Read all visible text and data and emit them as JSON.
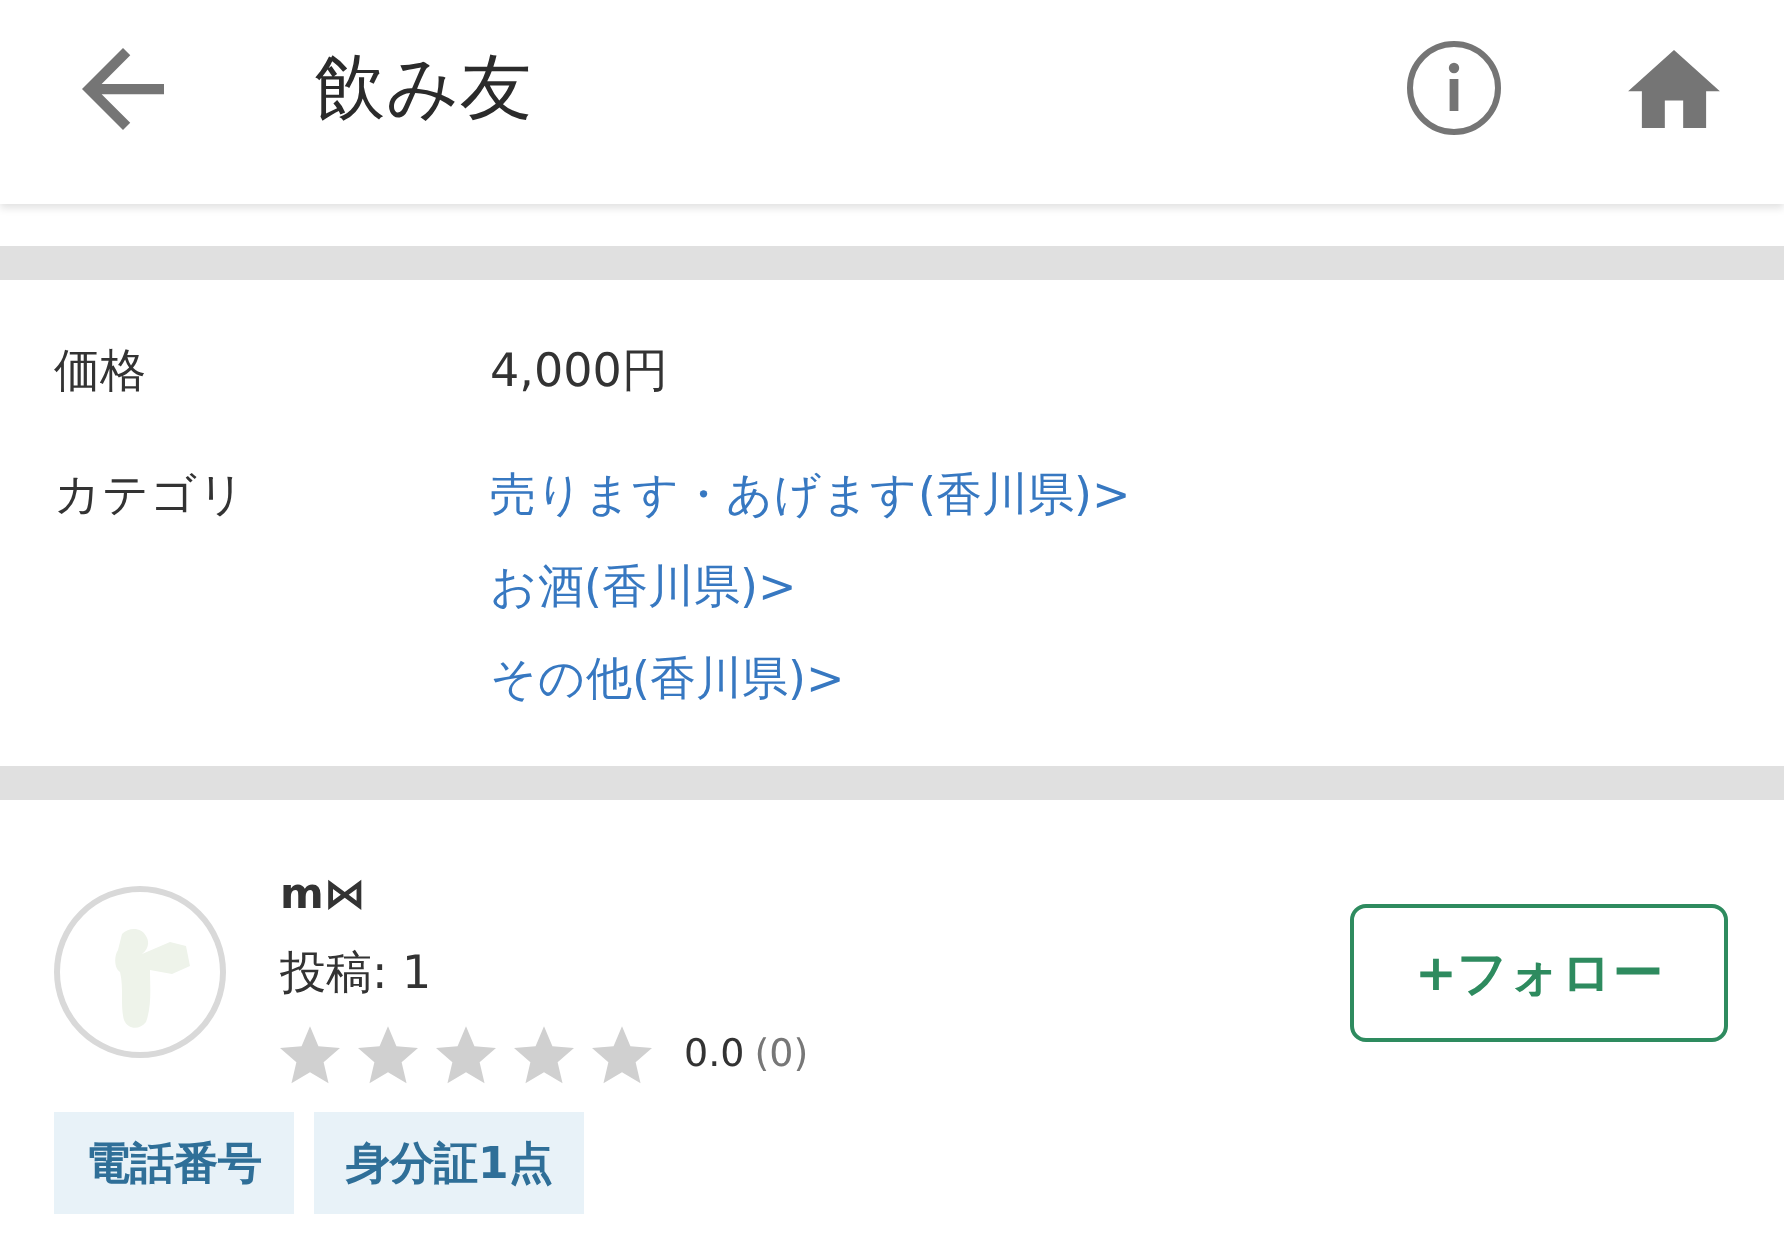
{
  "header": {
    "title": "飲み友"
  },
  "details": [
    {
      "label": "価格",
      "values": [
        {
          "text": "4,000円",
          "kind": "text"
        }
      ]
    },
    {
      "label": "カテゴリ",
      "values": [
        {
          "text": "売ります・あげます(香川県)>",
          "kind": "link"
        },
        {
          "text": "お酒(香川県)>",
          "kind": "link"
        },
        {
          "text": "その他(香川県)>",
          "kind": "link"
        }
      ]
    }
  ],
  "user": {
    "name": "m⋈",
    "posts": "投稿: 1",
    "stars": 0,
    "rating": "0.0",
    "review_count": "(0)",
    "follow_button": "+フォロー",
    "badges": [
      "電話番号",
      "身分証1点"
    ]
  }
}
